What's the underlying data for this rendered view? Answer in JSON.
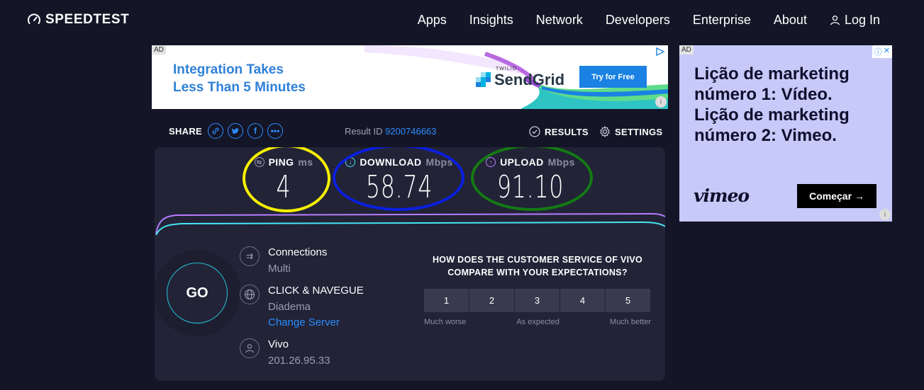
{
  "header": {
    "brand": "SPEEDTEST",
    "nav": [
      {
        "label": "Apps"
      },
      {
        "label": "Insights"
      },
      {
        "label": "Network"
      },
      {
        "label": "Developers"
      },
      {
        "label": "Enterprise"
      },
      {
        "label": "About"
      },
      {
        "label": "Log In"
      }
    ]
  },
  "ads": {
    "top": {
      "ad_label": "AD",
      "headline_line1": "Integration Takes",
      "headline_line2": "Less Than 5 Minutes",
      "twilio": "TWILIO",
      "brand": "SendGrid",
      "cta": "Try for Free"
    },
    "side": {
      "ad_label": "AD",
      "line1": "Lição de marketing número 1: Vídeo.",
      "line2": "Lição de marketing número 2: Vimeo.",
      "brand": "vimeo",
      "cta": "Começar →"
    }
  },
  "share": {
    "label": "SHARE",
    "result_id_label": "Result ID",
    "result_id": "9200746663",
    "results_label": "RESULTS",
    "settings_label": "SETTINGS"
  },
  "metrics": {
    "ping": {
      "label": "PING",
      "unit": "ms",
      "value": "4",
      "ring_color": "#f5f000"
    },
    "download": {
      "label": "DOWNLOAD",
      "unit": "Mbps",
      "value": "58.74",
      "ring_color": "#0a1fe0"
    },
    "upload": {
      "label": "UPLOAD",
      "unit": "Mbps",
      "value": "91.10",
      "ring_color": "#137a13"
    }
  },
  "go_label": "GO",
  "connection": {
    "connections_title": "Connections",
    "connections_value": "Multi",
    "server_title": "CLICK & NAVEGUE",
    "server_location": "Diadema",
    "change_server": "Change Server",
    "isp_title": "Vivo",
    "isp_ip": "201.26.95.33"
  },
  "survey": {
    "question": "HOW DOES THE CUSTOMER SERVICE OF VIVO COMPARE WITH YOUR EXPECTATIONS?",
    "options": [
      "1",
      "2",
      "3",
      "4",
      "5"
    ],
    "label_low": "Much worse",
    "label_mid": "As expected",
    "label_high": "Much better"
  },
  "colors": {
    "background": "#141526",
    "panel": "#222337",
    "accent_blue": "#2b8cff",
    "download_line": "#45e6f2",
    "upload_line": "#b67cff"
  }
}
